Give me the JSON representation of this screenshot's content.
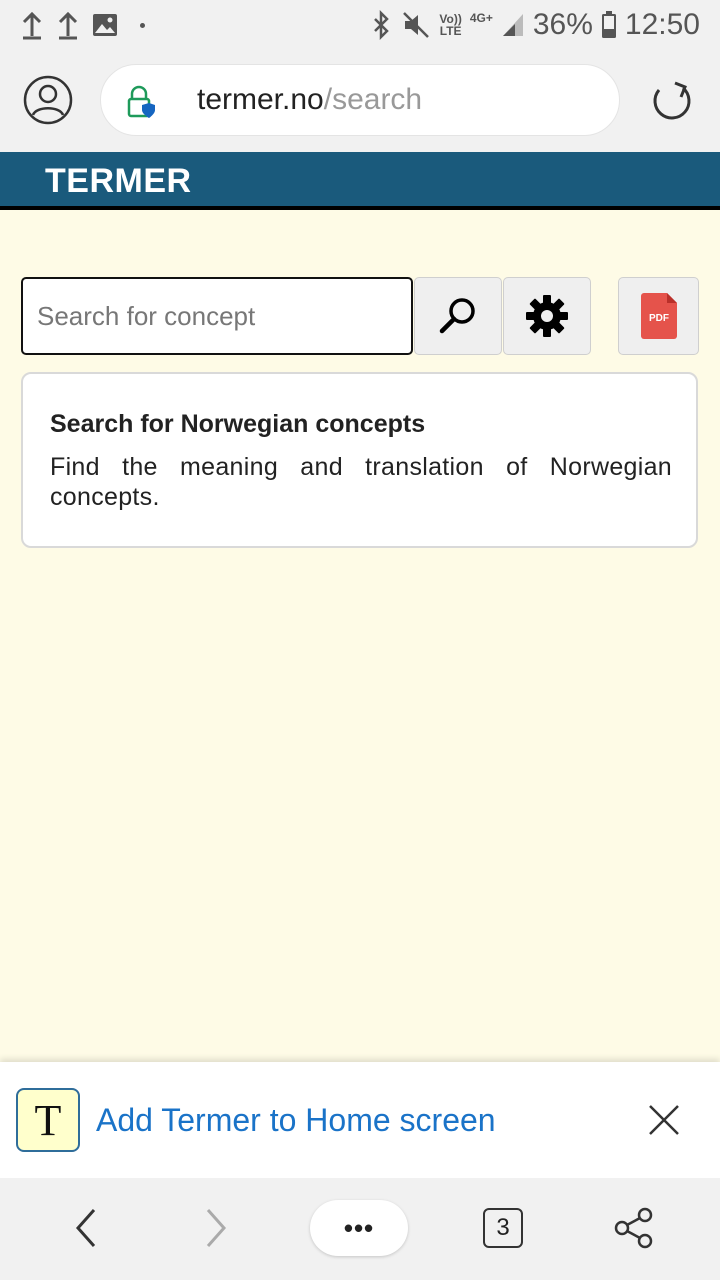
{
  "status_bar": {
    "signal_label_top": "Vo))",
    "signal_label_bottom": "LTE",
    "network_label": "4G+",
    "battery": "36%",
    "time": "12:50"
  },
  "address_bar": {
    "url_domain": "termer.no",
    "url_path": "/search"
  },
  "site": {
    "title": "TERMER"
  },
  "search": {
    "placeholder": "Search for concept",
    "pdf_label": "PDF"
  },
  "info": {
    "title": "Search for Norwegian concepts",
    "body": "Find the meaning and translation of Norwegian concepts."
  },
  "a2hs": {
    "icon_letter": "T",
    "text": "Add Termer to Home screen"
  },
  "bottom_nav": {
    "more_label": "•••",
    "tab_count": "3"
  },
  "colors": {
    "header_bg": "#1a5a7c",
    "page_bg": "#fefbe6",
    "link_blue": "#1a73c8",
    "pdf_red": "#e5534b"
  }
}
